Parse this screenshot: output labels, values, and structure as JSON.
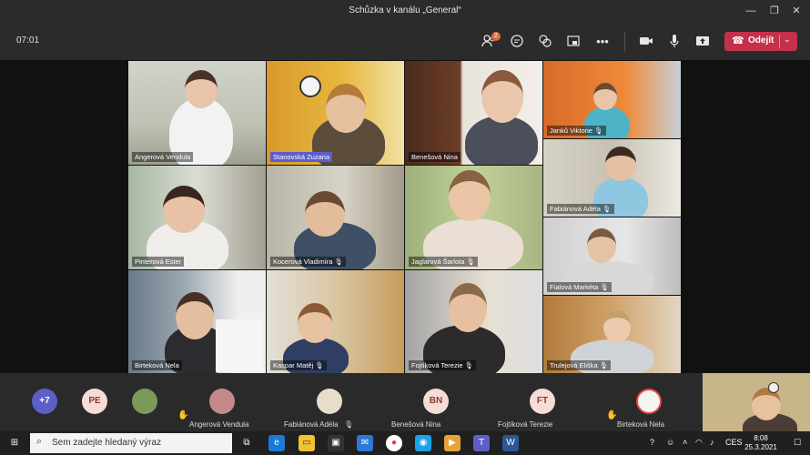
{
  "window": {
    "title": "Schůzka v kanálu „General“"
  },
  "toolbar": {
    "timer": "07:01",
    "participants_badge": "2",
    "leave_label": "Odejít"
  },
  "tiles": [
    {
      "name": "Angerová Vendula",
      "mic": false
    },
    {
      "name": "Stanovská Zuzana",
      "mic": false
    },
    {
      "name": "Benešová Nina",
      "mic": false
    },
    {
      "name": "Janků Viktorie",
      "mic": true
    },
    {
      "name": "Fabiánová Adéla",
      "mic": true
    },
    {
      "name": "Pinterová Ester",
      "mic": false
    },
    {
      "name": "Kocerová Vladimíra",
      "mic": true
    },
    {
      "name": "Jaglarová Šarlota",
      "mic": true
    },
    {
      "name": "Fialová Markéta",
      "mic": true
    },
    {
      "name": "Birteková Nela",
      "mic": false
    },
    {
      "name": "Kaspar Matěj",
      "mic": true
    },
    {
      "name": "Fojtíková Terezie",
      "mic": true
    },
    {
      "name": "Trulejová Eliška",
      "mic": true
    }
  ],
  "strip": {
    "overflow_count": "+7",
    "items": [
      {
        "initials": "PE",
        "name": ""
      },
      {
        "initials": "",
        "name": ""
      },
      {
        "initials": "",
        "name": "Angerová Vendula",
        "hand": true
      },
      {
        "initials": "",
        "name": "Fabiánová Adéla",
        "muted": true
      },
      {
        "initials": "BN",
        "name": "Benešová Nina"
      },
      {
        "initials": "FT",
        "name": "Fojtíková Terezie"
      },
      {
        "initials": "",
        "name": "Birteková Nela",
        "hand": true
      }
    ]
  },
  "taskbar": {
    "search_placeholder": "Sem zadejte hledaný výraz",
    "language": "CES",
    "time": "8:08",
    "date": "25.3.2021"
  },
  "colors": {
    "accent_leave": "#c4314b",
    "titlebar": "#2b2b2b"
  }
}
